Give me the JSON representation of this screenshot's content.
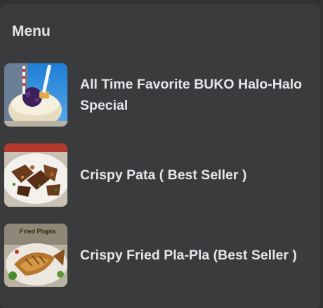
{
  "menu": {
    "title": "Menu",
    "items": [
      {
        "label": "All Time Favorite BUKO Halo-Halo Special",
        "image": "halo-halo-photo"
      },
      {
        "label": "Crispy Pata ( Best Seller )",
        "image": "crispy-pata-photo"
      },
      {
        "label": "Crispy Fried Pla-Pla (Best Seller )",
        "image": "fried-pla-pla-photo",
        "image_caption": "Fried Plapla"
      }
    ]
  },
  "colors": {
    "background": "#2f3133",
    "card": "#3a3b3c",
    "text": "#e4e6eb"
  }
}
